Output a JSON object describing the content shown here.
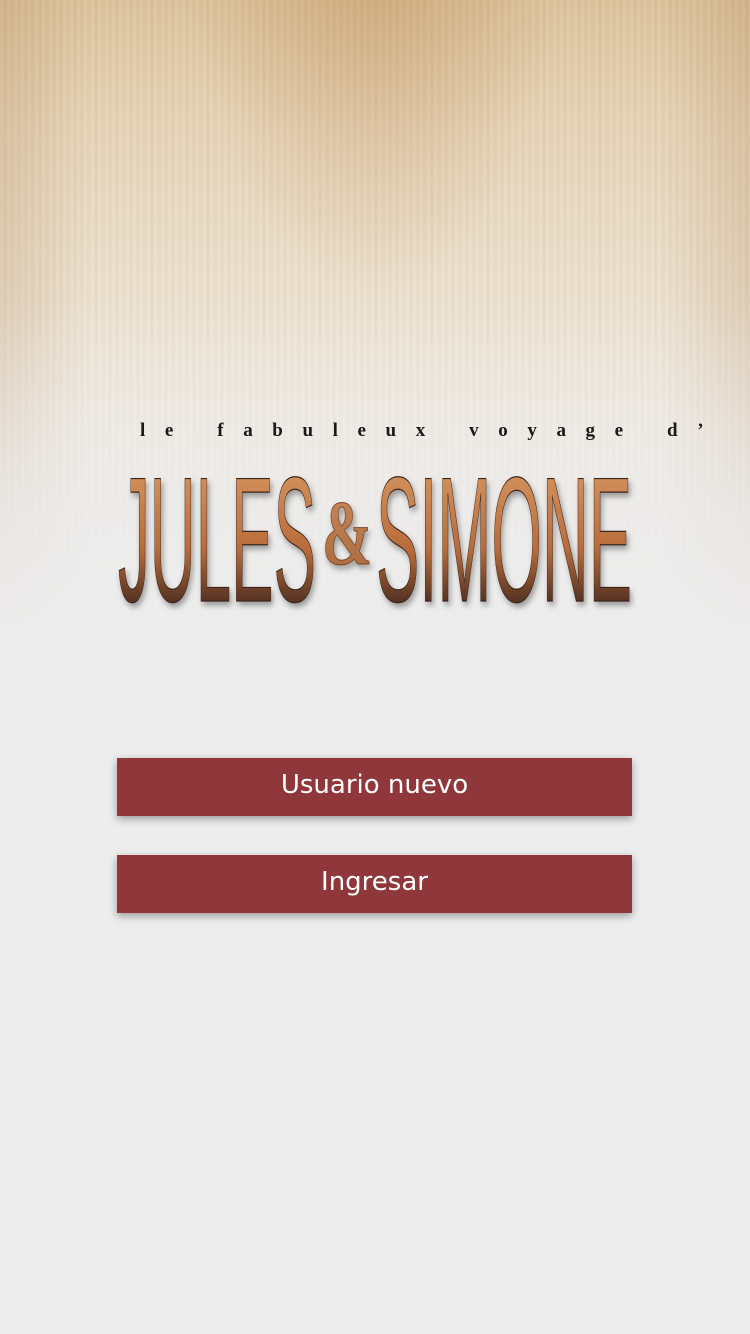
{
  "brand": {
    "tagline": "le fabuleux voyage d’",
    "name_part1": "JULES",
    "ampersand": "&",
    "name_part2": "SIMONE"
  },
  "actions": {
    "new_user_label": "Usuario nuevo",
    "login_label": "Ingresar"
  },
  "colors": {
    "button": "#8f373a",
    "background": "#ededed",
    "logo_top": "#d08a55",
    "logo_bottom": "#2e1f18"
  }
}
